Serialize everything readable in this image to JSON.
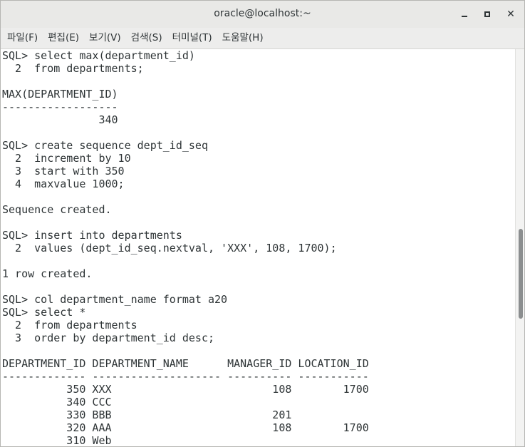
{
  "window": {
    "title": "oracle@localhost:~"
  },
  "controls": {
    "minimize": "",
    "maximize": "",
    "close": "✕"
  },
  "menu": [
    "파일(F)",
    "편집(E)",
    "보기(V)",
    "검색(S)",
    "터미널(T)",
    "도움말(H)"
  ],
  "terminal": {
    "lines": [
      "SQL> select max(department_id)",
      "  2  from departments;",
      "",
      "MAX(DEPARTMENT_ID)",
      "------------------",
      "               340",
      "",
      "SQL> create sequence dept_id_seq",
      "  2  increment by 10",
      "  3  start with 350",
      "  4  maxvalue 1000;",
      "",
      "Sequence created.",
      "",
      "SQL> insert into departments",
      "  2  values (dept_id_seq.nextval, 'XXX', 108, 1700);",
      "",
      "1 row created.",
      "",
      "SQL> col department_name format a20",
      "SQL> select *",
      "  2  from departments",
      "  3  order by department_id desc;",
      "",
      "DEPARTMENT_ID DEPARTMENT_NAME      MANAGER_ID LOCATION_ID",
      "------------- -------------------- ---------- -----------",
      "          350 XXX                         108        1700",
      "          340 CCC",
      "          330 BBB                         201",
      "          320 AAA                         108        1700",
      "          310 Web"
    ]
  }
}
